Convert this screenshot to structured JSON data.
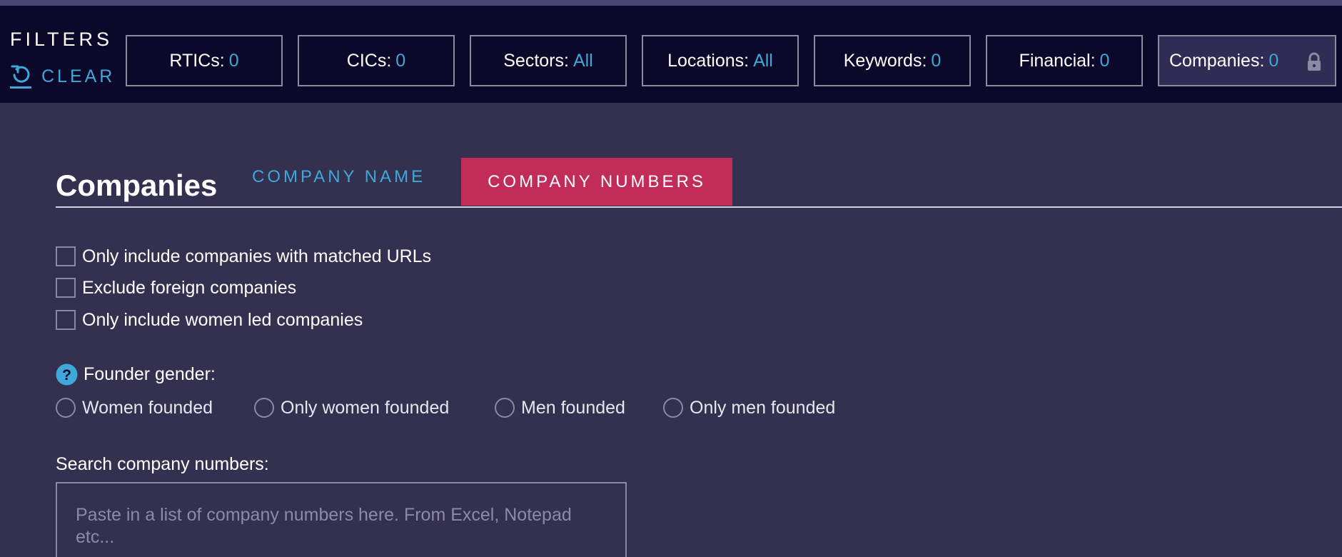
{
  "filterbar": {
    "title": "FILTERS",
    "clear_label": "CLEAR",
    "chips": [
      {
        "label": "RTICs:",
        "value": "0"
      },
      {
        "label": "CICs:",
        "value": "0"
      },
      {
        "label": "Sectors:",
        "value": "All"
      },
      {
        "label": "Locations:",
        "value": "All"
      },
      {
        "label": "Keywords:",
        "value": "0"
      },
      {
        "label": "Financial:",
        "value": "0"
      },
      {
        "label": "Companies:",
        "value": "0"
      }
    ]
  },
  "companies": {
    "title": "Companies",
    "tabs": [
      {
        "label": "COMPANY NAME",
        "active": false
      },
      {
        "label": "COMPANY NUMBERS",
        "active": true
      }
    ],
    "checkboxes": [
      {
        "label": "Only include companies with matched URLs",
        "checked": false
      },
      {
        "label": "Exclude foreign companies",
        "checked": false
      },
      {
        "label": "Only include women led companies",
        "checked": false
      }
    ],
    "founder_gender_label": "Founder gender:",
    "gender_options": [
      {
        "label": "Women founded",
        "selected": false
      },
      {
        "label": "Only women founded",
        "selected": false
      },
      {
        "label": "Men founded",
        "selected": false
      },
      {
        "label": "Only men founded",
        "selected": false
      }
    ],
    "search": {
      "label": "Search company numbers:",
      "placeholder": "Paste in a list of company numbers here. From Excel, Notepad etc...",
      "value": ""
    }
  },
  "colors": {
    "accent": "#3ea8d8",
    "active_tab": "#c22c59",
    "background": "#34304f",
    "filterbar": "#0b0829"
  },
  "icons": {
    "clear": "undo-arrow-icon",
    "companies_chip": "lock-icon",
    "founder_gender": "help-icon"
  }
}
